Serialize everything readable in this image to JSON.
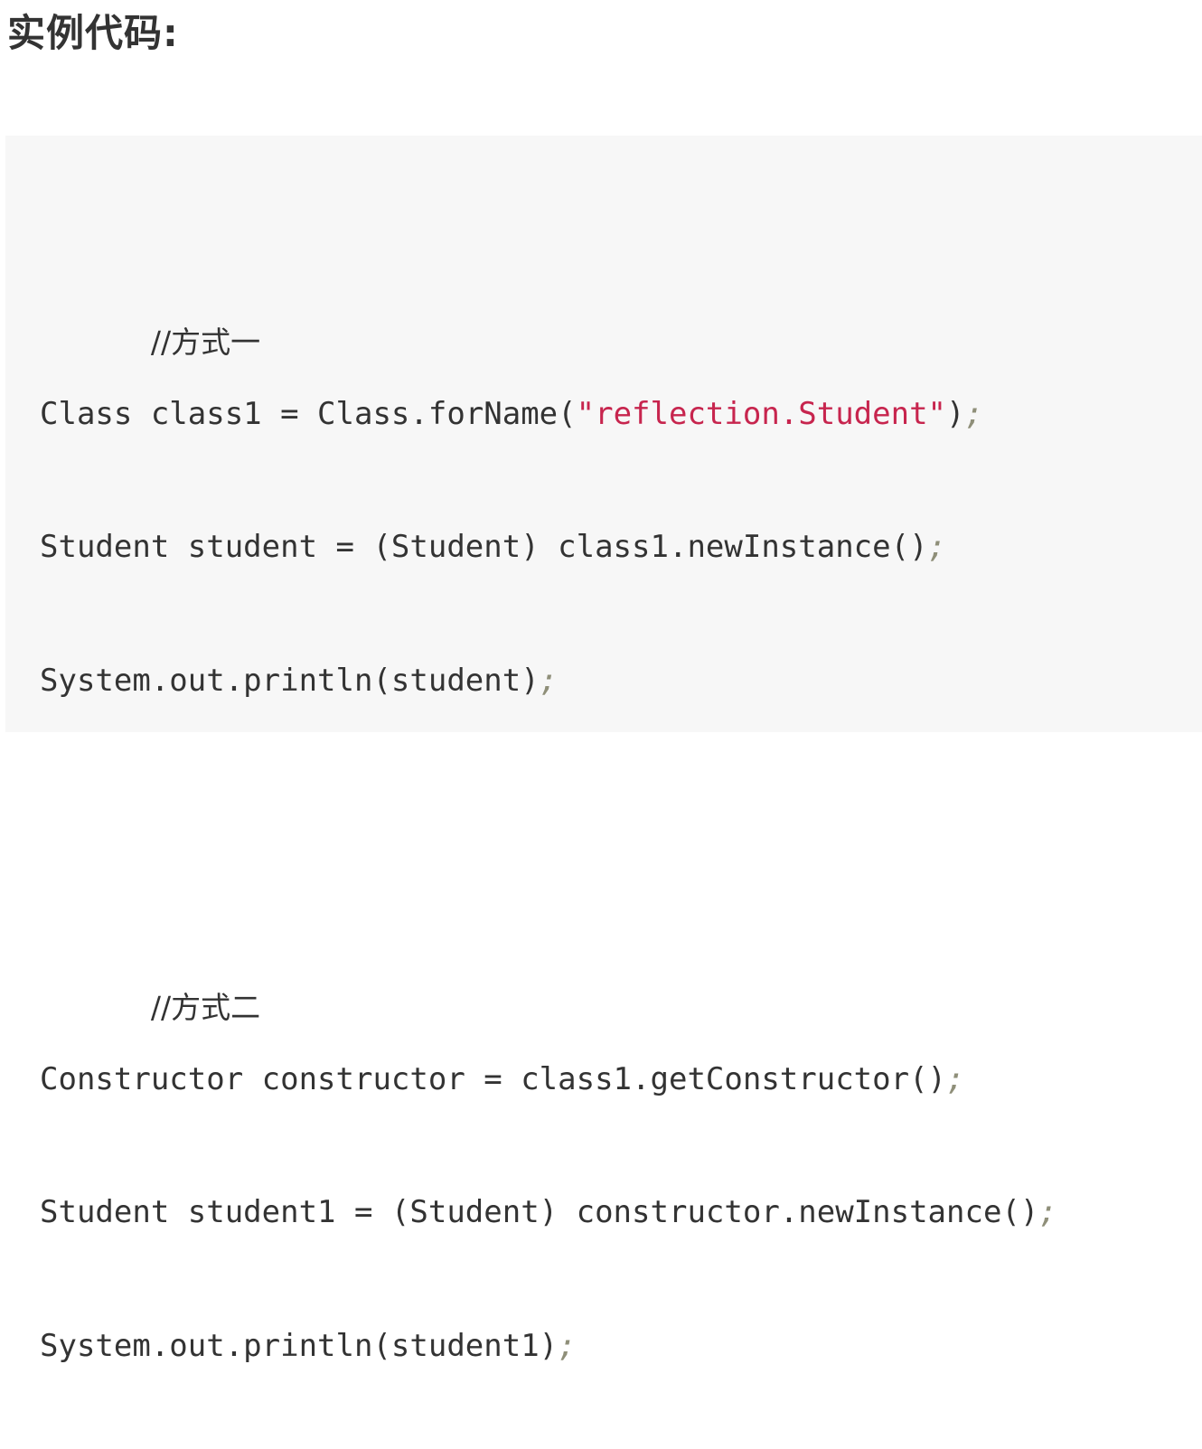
{
  "heading": "实例代码:",
  "code": {
    "lines": [
      {
        "kind": "comment",
        "text": "//方式一"
      },
      {
        "kind": "code",
        "before": "Class class1 = Class.forName(",
        "string": "\"reflection.Student\"",
        "after": ")",
        "semi": ";"
      },
      {
        "kind": "code",
        "before": "Student student = (Student) class1.newInstance()",
        "semi": ";"
      },
      {
        "kind": "code",
        "before": "System.out.println(student)",
        "semi": ";"
      },
      {
        "kind": "blank"
      },
      {
        "kind": "comment",
        "text": "//方式二"
      },
      {
        "kind": "code",
        "before": "Constructor constructor = class1.getConstructor()",
        "semi": ";"
      },
      {
        "kind": "code",
        "before": "Student student1 = (Student) constructor.newInstance()",
        "semi": ";"
      },
      {
        "kind": "code",
        "before": "System.out.println(student1)",
        "semi": ";"
      }
    ]
  },
  "colors": {
    "string": "#c7254e",
    "semicolon": "#8f8f79",
    "code_background": "#f7f7f7",
    "text": "#333333"
  }
}
